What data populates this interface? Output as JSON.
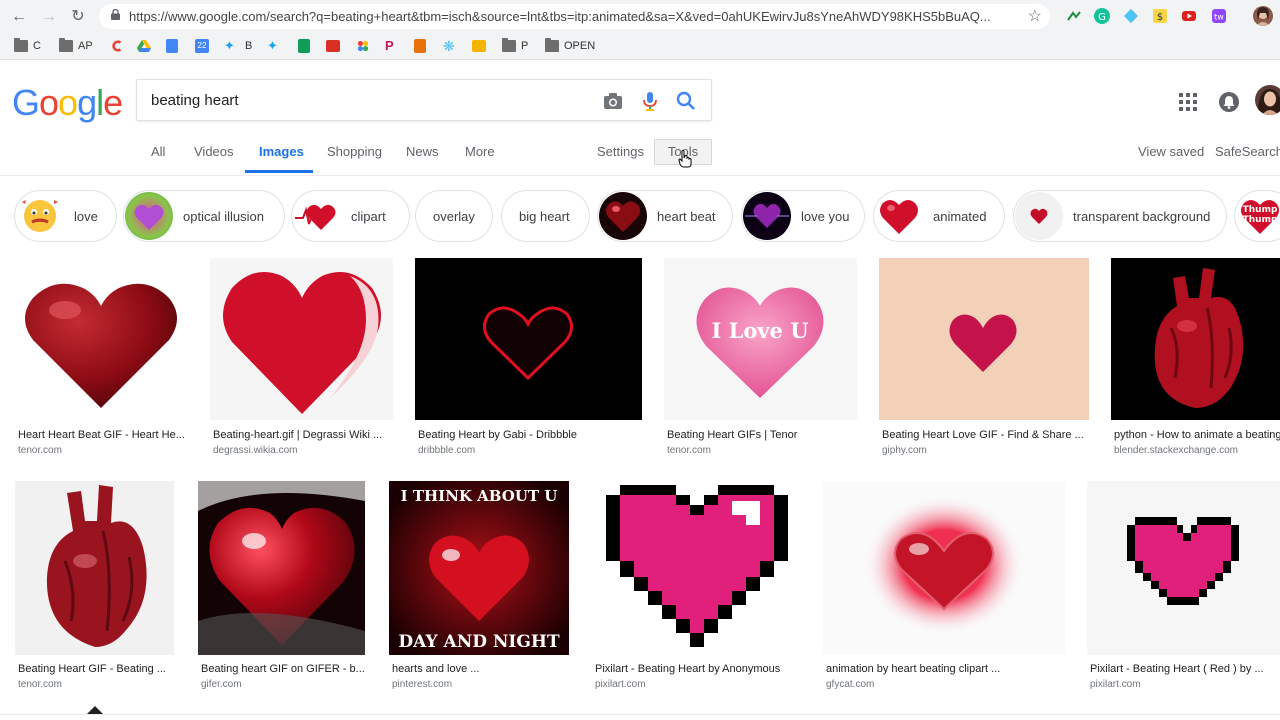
{
  "browser": {
    "url": "https://www.google.com/search?q=beating+heart&tbm=isch&source=lnt&tbs=itp:animated&sa=X&ved=0ahUKEwirvJu8sYneAhWDY98KHS5bBuAQ...",
    "bookmarks": [
      {
        "label": "C",
        "icon": "folder-icon"
      },
      {
        "label": "AP",
        "icon": "folder-icon"
      },
      {
        "label": "",
        "icon": "c-logo-icon"
      },
      {
        "label": "",
        "icon": "drive-icon"
      },
      {
        "label": "",
        "icon": "docs-icon"
      },
      {
        "label": "",
        "icon": "calendar-icon"
      },
      {
        "label": "B",
        "icon": "twitter-icon"
      },
      {
        "label": "",
        "icon": "twitter-icon"
      },
      {
        "label": "",
        "icon": "sheets-icon"
      },
      {
        "label": "",
        "icon": "image-icon"
      },
      {
        "label": "",
        "icon": "photos-icon"
      },
      {
        "label": "",
        "icon": "p-icon"
      },
      {
        "label": "",
        "icon": "bag-icon"
      },
      {
        "label": "",
        "icon": "spark-icon"
      },
      {
        "label": "",
        "icon": "slides-icon"
      },
      {
        "label": "P",
        "icon": "folder-icon"
      },
      {
        "label": "OPEN",
        "icon": "folder-icon"
      }
    ],
    "calendar_day": "22"
  },
  "search": {
    "query": "beating heart",
    "logo": [
      "G",
      "o",
      "o",
      "g",
      "l",
      "e"
    ]
  },
  "tabs": [
    "All",
    "Videos",
    "Images",
    "Shopping",
    "News",
    "More"
  ],
  "settings_label": "Settings",
  "tools_label": "Tools",
  "view_saved_label": "View saved",
  "safesearch_label": "SafeSearch",
  "chips": [
    {
      "label": "love",
      "thumb": "emoji"
    },
    {
      "label": "optical illusion",
      "thumb": "gradient"
    },
    {
      "label": "clipart",
      "thumb": "ekg"
    },
    {
      "label": "overlay",
      "thumb": ""
    },
    {
      "label": "big heart",
      "thumb": ""
    },
    {
      "label": "heart beat",
      "thumb": "dark"
    },
    {
      "label": "love you",
      "thumb": "purple"
    },
    {
      "label": "animated",
      "thumb": "red"
    },
    {
      "label": "transparent background",
      "thumb": "smallred"
    },
    {
      "label": "Thump Thump",
      "thumb": "partial"
    }
  ],
  "results_row1": [
    {
      "title": "Heart Heart Beat GIF - Heart He...",
      "domain": "tenor.com"
    },
    {
      "title": "Beating-heart.gif | Degrassi Wiki ...",
      "domain": "degrassi.wikia.com"
    },
    {
      "title": "Beating Heart by Gabi - Dribbble",
      "domain": "dribbble.com"
    },
    {
      "title": "Beating Heart GIFs | Tenor",
      "domain": "tenor.com"
    },
    {
      "title": "Beating Heart Love GIF - Find & Share ...",
      "domain": "giphy.com"
    },
    {
      "title": "python - How to animate a beating heart ...",
      "domain": "blender.stackexchange.com"
    }
  ],
  "results_row2": [
    {
      "title": "Beating Heart GIF - Beating ...",
      "domain": "tenor.com"
    },
    {
      "title": "Beating heart GIF on GIFER - b...",
      "domain": "gifer.com"
    },
    {
      "title": "hearts and love ...",
      "domain": "pinterest.com"
    },
    {
      "title": "Pixilart - Beating Heart by Anonymous",
      "domain": "pixilart.com"
    },
    {
      "title": "animation by heart beating clipart ...",
      "domain": "gfycat.com"
    },
    {
      "title": "Pixilart - Beating Heart ( Red ) by ...",
      "domain": "pixilart.com"
    }
  ],
  "image_texts": {
    "i_love_u": "I Love U",
    "think_top": "I THINK ABOUT U",
    "think_bottom": "DAY AND NIGHT"
  },
  "colors": {
    "accent": "#1a73e8",
    "heart_red": "#d0102a",
    "heart_pink": "#d81b72"
  }
}
